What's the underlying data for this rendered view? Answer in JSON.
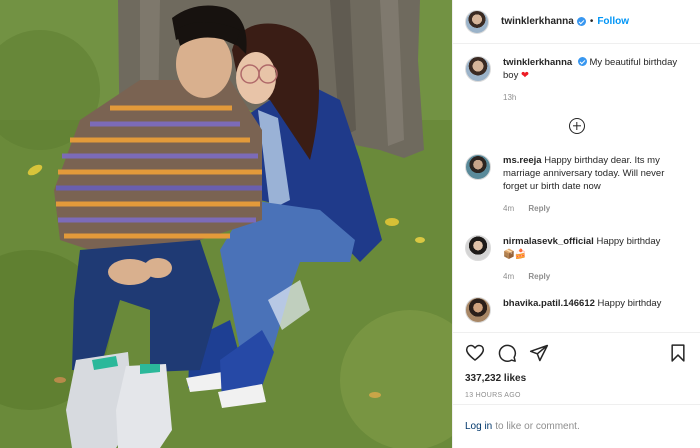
{
  "post": {
    "photo_alt": "Post photo"
  },
  "header": {
    "username": "twinklerkhanna",
    "separator": "•",
    "follow_label": "Follow",
    "more_label": "•••"
  },
  "caption": {
    "username": "twinklerkhanna",
    "text": "My beautiful birthday boy",
    "emoji": "❤",
    "time": "13h"
  },
  "comments": [
    {
      "username": "ms.reeja",
      "text": "Happy birthday dear. Its my marriage anniversary today. Will never forget ur birth date now",
      "time": "4m",
      "reply_label": "Reply"
    },
    {
      "username": "nirmalasevk_official",
      "text": "Happy birthday",
      "emoji": "📦🍰",
      "time": "4m",
      "reply_label": "Reply"
    },
    {
      "username": "bhavika.patil.146612",
      "text": "Happy birthday",
      "time": "",
      "reply_label": ""
    }
  ],
  "actions": {
    "icons": [
      "heart-icon",
      "comment-icon",
      "share-icon",
      "bookmark-icon"
    ],
    "likes": "337,232 likes",
    "timestamp": "13 HOURS AGO"
  },
  "login": {
    "link_label": "Log in",
    "suffix": "to like or comment."
  },
  "colors": {
    "accent": "#0095f6",
    "verified": "#3897f0",
    "muted": "#8e8e8e",
    "text": "#262626",
    "login_link": "#00376b"
  }
}
